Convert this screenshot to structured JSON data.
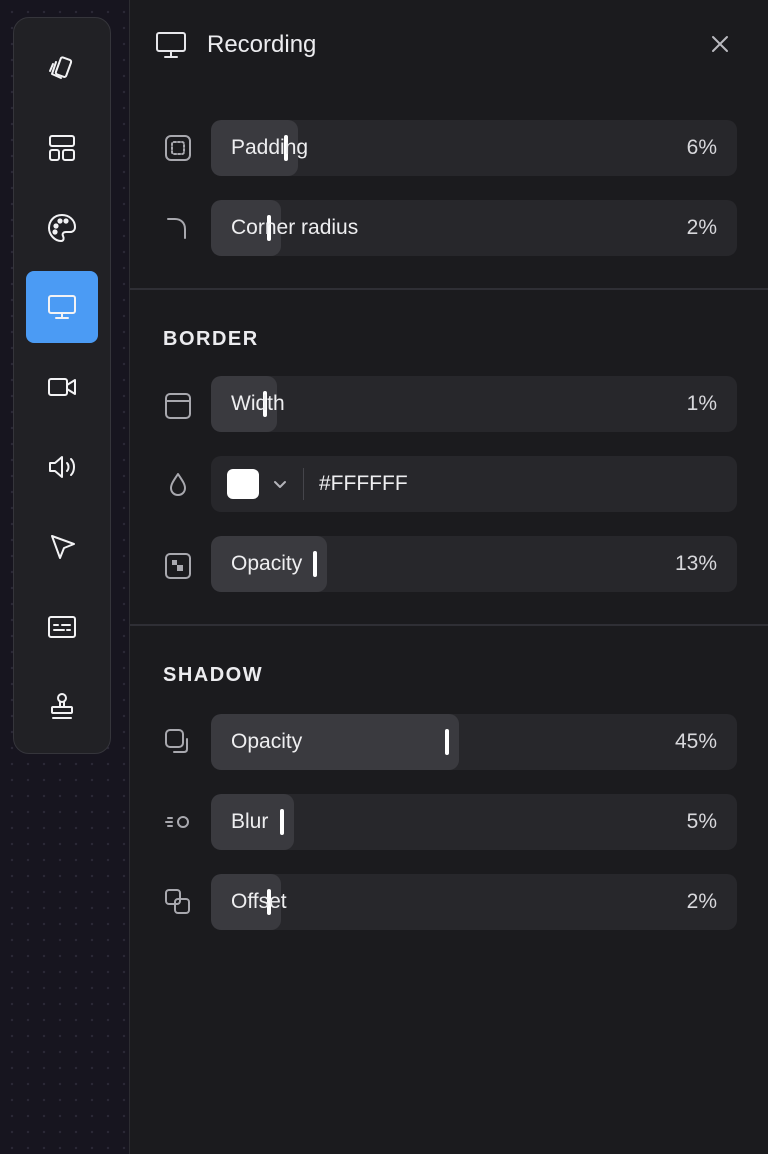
{
  "toolbar": {
    "tools": [
      {
        "icon": "cards-icon"
      },
      {
        "icon": "layout-icon"
      },
      {
        "icon": "palette-icon"
      },
      {
        "icon": "monitor-icon",
        "active": true
      },
      {
        "icon": "video-camera-icon"
      },
      {
        "icon": "speaker-icon"
      },
      {
        "icon": "cursor-icon"
      },
      {
        "icon": "captions-icon"
      },
      {
        "icon": "stamp-icon"
      }
    ],
    "accent": "#4b9bf4"
  },
  "header": {
    "icon": "monitor-icon",
    "title": "Recording",
    "close_icon": "close-icon"
  },
  "general": {
    "padding": {
      "label": "Padding",
      "value": "6%",
      "level": 0.06
    },
    "corner_radius": {
      "label": "Corner radius",
      "value": "2%",
      "level": 0.02
    }
  },
  "border": {
    "title": "BORDER",
    "width": {
      "label": "Width",
      "value": "1%",
      "level": 0.01
    },
    "color": {
      "hex": "#FFFFFF",
      "swatch": "#FFFFFF"
    },
    "opacity": {
      "label": "Opacity",
      "value": "13%",
      "level": 0.13
    }
  },
  "shadow": {
    "title": "SHADOW",
    "opacity": {
      "label": "Opacity",
      "value": "45%",
      "level": 0.45
    },
    "blur": {
      "label": "Blur",
      "value": "5%",
      "level": 0.05
    },
    "offset": {
      "label": "Offset",
      "value": "2%",
      "level": 0.02
    }
  }
}
